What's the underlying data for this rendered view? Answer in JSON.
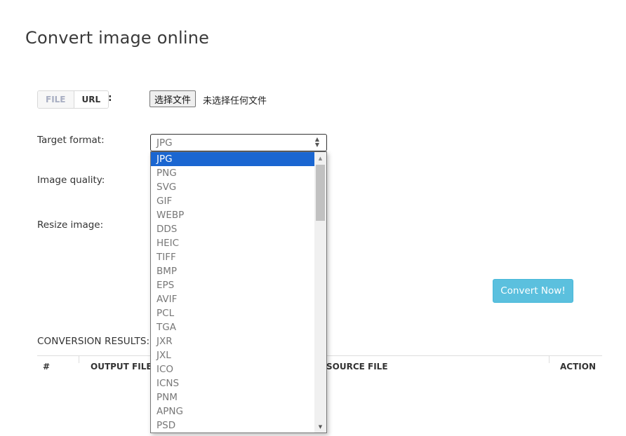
{
  "page": {
    "title": "Convert image online"
  },
  "source_toggle": {
    "file_label": "FILE",
    "url_label": "URL",
    "colon": ":",
    "active": "URL"
  },
  "file_input": {
    "button_label": "选择文件",
    "status_text": "未选择任何文件"
  },
  "form": {
    "target_format_label": "Target format:",
    "image_quality_label": "Image quality:",
    "resize_image_label": "Resize image:"
  },
  "target_format": {
    "selected": "JPG",
    "options": [
      "JPG",
      "PNG",
      "SVG",
      "GIF",
      "WEBP",
      "DDS",
      "HEIC",
      "TIFF",
      "BMP",
      "EPS",
      "AVIF",
      "PCL",
      "TGA",
      "JXR",
      "JXL",
      "ICO",
      "ICNS",
      "PNM",
      "APNG",
      "PSD"
    ],
    "highlight_color": "#1a66d1"
  },
  "actions": {
    "convert_label": "Convert Now!",
    "convert_color": "#5bc0de"
  },
  "results": {
    "label": "CONVERSION RESULTS:",
    "columns": [
      "#",
      "OUTPUT FILE",
      "SOURCE FILE",
      "ACTION"
    ]
  }
}
